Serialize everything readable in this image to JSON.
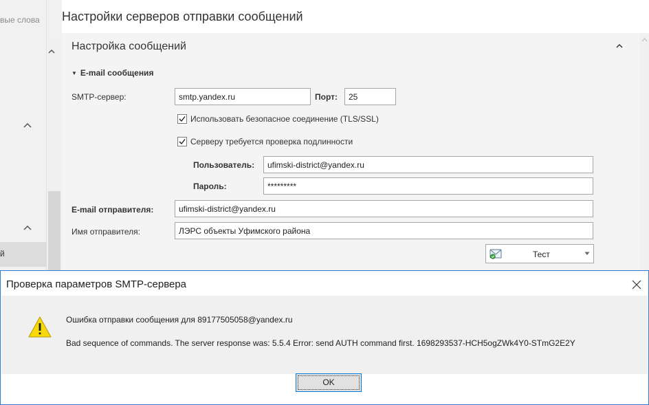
{
  "left_pane": {
    "keywords_fragment": "вые слова",
    "selected_fragment": "й"
  },
  "main": {
    "title": "Настройки серверов отправки сообщений",
    "section_title": "Настройка сообщений",
    "email_group": {
      "title": "E-mail сообщения",
      "smtp_label": "SMTP-сервер:",
      "smtp_value": "smtp.yandex.ru",
      "port_label": "Порт:",
      "port_value": "25",
      "ssl_checkbox": {
        "label": "Использовать безопасное соединение (TLS/SSL)",
        "checked": true
      },
      "auth_checkbox": {
        "label": "Серверу требуется проверка подлинности",
        "checked": true
      },
      "user_label": "Пользователь:",
      "user_value": "ufimski-district@yandex.ru",
      "password_label": "Пароль:",
      "password_value": "*********",
      "sender_email_label": "E-mail отправителя:",
      "sender_email_value": "ufimski-district@yandex.ru",
      "sender_name_label": "Имя отправителя:",
      "sender_name_value": "ЛЭРС объекты Уфимского района",
      "test_button_label": "Тест"
    }
  },
  "dialog": {
    "title": "Проверка параметров SMTP-сервера",
    "message_line1": "Ошибка отправки сообщения для 89177505058@yandex.ru",
    "message_line2": "Bad sequence of commands. The server response was: 5.5.4 Error: send AUTH command first. 1698293537-HCH5ogZWk4Y0-STmG2E2Y",
    "ok_label": "OK"
  },
  "icons": {
    "chevron": "chevron-up-icon",
    "expand": "triangle-down-icon",
    "check": "checkmark-icon",
    "envelope": "envelope-icon",
    "dropdown": "dropdown-arrow-icon",
    "warning": "warning-icon",
    "close": "close-icon"
  },
  "colors": {
    "dialog_border": "#2e7bcf",
    "warning_yellow": "#f7d80b",
    "ok_focus": "#0078d7"
  }
}
